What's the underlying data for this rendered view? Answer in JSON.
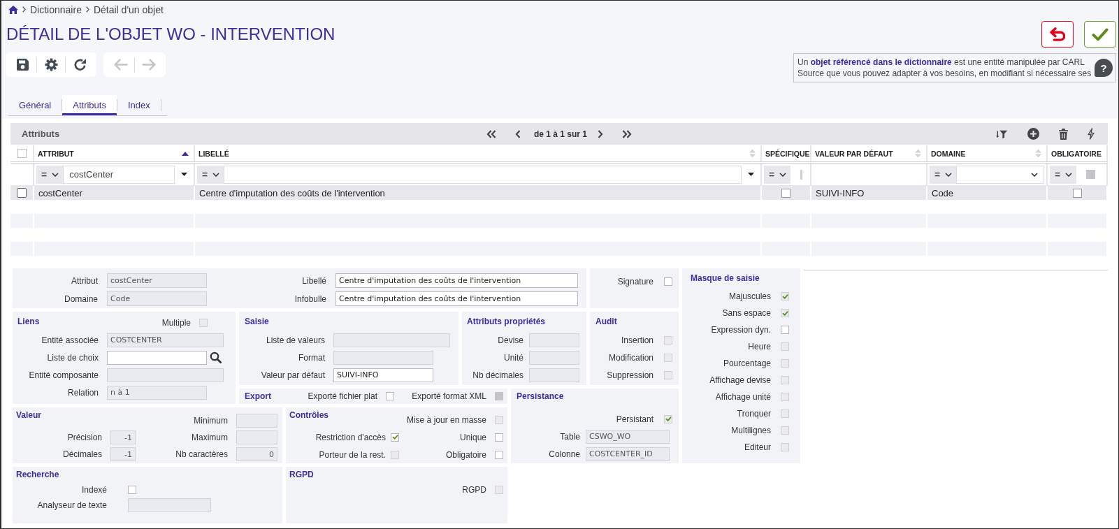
{
  "breadcrumb": [
    {
      "label": "Dictionnaire"
    },
    {
      "label": "Détail d'un objet"
    }
  ],
  "title": "DÉTAIL DE L'OBJET WO - INTERVENTION",
  "toolbar": [
    [
      {
        "kind": "save",
        "disabled": false
      },
      {
        "kind": "settings",
        "disabled": false
      },
      {
        "kind": "refresh",
        "disabled": false
      }
    ],
    [
      {
        "kind": "previous",
        "disabled": true
      },
      {
        "kind": "next",
        "disabled": true
      }
    ]
  ],
  "info": {
    "text": "Un **objet référencé dans le dictionnaire** est une entité manipulée par CARL\nSource que vous pouvez adapter à vos besoins, en modifiant si nécessaire ses",
    "help": "?"
  },
  "tabs": [
    {
      "label": "Général",
      "selected": false
    },
    {
      "label": "Attributs",
      "selected": true
    },
    {
      "label": "Index",
      "selected": false
    }
  ],
  "table": {
    "title": "Attributs",
    "pagination": "de 1 à 1 sur 1",
    "select_all": {
      "checked": false
    },
    "columns": [
      {
        "label": "ATTRIBUT",
        "sorted": true
      },
      {
        "label": "LIBELLÉ",
        "sorted": false
      },
      {
        "label": "SPÉCIFIQUE"
      },
      {
        "label": "VALEUR PAR DÉFAUT",
        "sorted": false
      },
      {
        "label": "DOMAINE",
        "sorted": false
      },
      {
        "label": "OBLIGATOIRE"
      }
    ],
    "filters": [
      {
        "kind": "text",
        "operator": "=",
        "value": "costCenter"
      },
      {
        "kind": "text",
        "operator": "="
      },
      {
        "kind": "clipped",
        "operator": "=",
        "checked": false,
        "indeterminate": true
      },
      {
        "kind": "none"
      },
      {
        "kind": "select",
        "operator": "="
      },
      {
        "kind": "checkbox",
        "operator": "=",
        "checked": false,
        "indeterminate": true
      }
    ],
    "rows": [
      {
        "selected": true,
        "checked": false,
        "cells": [
          {
            "kind": "text",
            "text": "costCenter"
          },
          {
            "kind": "text",
            "text": "Centre d'imputation des coûts de l'intervention"
          },
          {
            "kind": "checkbox",
            "checked": false
          },
          {
            "kind": "text",
            "text": "SUIVI-INFO"
          },
          {
            "kind": "text",
            "text": "Code"
          },
          {
            "kind": "checkbox",
            "checked": false
          }
        ]
      }
    ]
  },
  "detail": {
    "sections": [
      {
        "fields": [
          {
            "label": "Attribut",
            "kind": "text",
            "value": "costCenter",
            "readonly": true
          },
          {
            "label": "Libellé",
            "kind": "text",
            "value": "Centre d'imputation des coûts de l'intervention",
            "readonly": false
          },
          {
            "label": "Domaine",
            "kind": "text",
            "value": "Code",
            "readonly": true
          },
          {
            "label": "Infobulle",
            "kind": "text",
            "value": "Centre d'imputation des coûts de l'intervention",
            "readonly": false
          }
        ]
      },
      {
        "fields": [
          {
            "label": "Signature",
            "kind": "checkbox",
            "checked": false,
            "disabled": false
          }
        ]
      },
      {
        "title": "Liens",
        "fields": [
          {
            "label": "Multiple",
            "kind": "checkbox",
            "checked": false,
            "disabled": true
          },
          {
            "label": "Entité associée",
            "kind": "text",
            "value": "COSTCENTER",
            "readonly": true
          },
          {
            "label": "Liste de choix",
            "kind": "lookup",
            "readonly": false
          },
          {
            "label": "Entité composante",
            "kind": "text",
            "readonly": true
          },
          {
            "label": "Relation",
            "kind": "text",
            "value": "n à 1",
            "readonly": true
          }
        ]
      },
      {
        "title": "Saisie",
        "fields": [
          {
            "label": "Liste de valeurs",
            "kind": "text",
            "readonly": true
          },
          {
            "label": "Format",
            "kind": "text",
            "readonly": true
          },
          {
            "label": "Valeur par défaut",
            "kind": "text",
            "value": "SUIVI-INFO",
            "readonly": false
          }
        ]
      },
      {
        "title": "Attributs propriétés",
        "fields": [
          {
            "label": "Devise",
            "kind": "text",
            "readonly": true
          },
          {
            "label": "Unité",
            "kind": "text",
            "readonly": true
          },
          {
            "label": "Nb décimales",
            "kind": "text",
            "readonly": true
          }
        ]
      },
      {
        "title": "Audit",
        "fields": [
          {
            "label": "Insertion",
            "kind": "checkbox",
            "checked": false,
            "disabled": true
          },
          {
            "label": "Modification",
            "kind": "checkbox",
            "checked": false,
            "disabled": true
          },
          {
            "label": "Suppression",
            "kind": "checkbox",
            "checked": false,
            "disabled": true
          }
        ]
      },
      {
        "title": "Export",
        "fields": [
          {
            "label": "Exporté fichier plat",
            "kind": "checkbox",
            "checked": false,
            "disabled": false,
            "indeterminate": false
          },
          {
            "label": "Exporté format XML",
            "kind": "checkbox",
            "checked": false,
            "disabled": false,
            "indeterminate": true
          }
        ]
      },
      {
        "title": "Valeur",
        "fields": [
          {
            "label": "Minimum",
            "kind": "number",
            "readonly": true
          },
          {
            "label": "Précision",
            "kind": "number",
            "value": "-1",
            "readonly": true
          },
          {
            "label": "Maximum",
            "kind": "number",
            "readonly": true
          },
          {
            "label": "Décimales",
            "kind": "number",
            "value": "-1",
            "readonly": true
          },
          {
            "label": "Nb caractères",
            "kind": "number",
            "value": "0",
            "readonly": true
          }
        ]
      },
      {
        "title": "Contrôles",
        "fields": [
          {
            "label": "Mise à jour en masse",
            "kind": "checkbox",
            "checked": false,
            "disabled": true
          },
          {
            "label": "Restriction d'accès",
            "kind": "checkbox",
            "checked": true,
            "disabled": false
          },
          {
            "label": "Unique",
            "kind": "checkbox",
            "checked": false,
            "disabled": false
          },
          {
            "label": "Porteur de la rest.",
            "kind": "checkbox",
            "checked": false,
            "disabled": true
          },
          {
            "label": "Obligatoire",
            "kind": "checkbox",
            "checked": false,
            "disabled": false
          }
        ]
      },
      {
        "title": "Persistance",
        "fields": [
          {
            "label": "Persistant",
            "kind": "checkbox",
            "checked": true,
            "disabled": true
          },
          {
            "label": "Table",
            "kind": "text",
            "value": "CSWO_WO",
            "readonly": true
          },
          {
            "label": "Colonne",
            "kind": "text",
            "value": "COSTCENTER_ID",
            "readonly": true
          }
        ]
      },
      {
        "title": "Masque de saisie",
        "fields": [
          {
            "label": "Majuscules",
            "kind": "checkbox",
            "checked": true,
            "disabled": true
          },
          {
            "label": "Sans espace",
            "kind": "checkbox",
            "checked": true,
            "disabled": true
          },
          {
            "label": "Expression dyn.",
            "kind": "checkbox",
            "checked": false,
            "disabled": false
          },
          {
            "label": "Heure",
            "kind": "checkbox",
            "checked": false,
            "disabled": true
          },
          {
            "label": "Pourcentage",
            "kind": "checkbox",
            "checked": false,
            "disabled": true
          },
          {
            "label": "Affichage devise",
            "kind": "checkbox",
            "checked": false,
            "disabled": true
          },
          {
            "label": "Affichage unité",
            "kind": "checkbox",
            "checked": false,
            "disabled": true
          },
          {
            "label": "Tronquer",
            "kind": "checkbox",
            "checked": false,
            "disabled": true
          },
          {
            "label": "Multilignes",
            "kind": "checkbox",
            "checked": false,
            "disabled": true
          },
          {
            "label": "Editeur",
            "kind": "checkbox",
            "checked": false,
            "disabled": true
          }
        ]
      },
      {
        "title": "Recherche",
        "fields": [
          {
            "label": "Indexé",
            "kind": "checkbox",
            "checked": false,
            "disabled": false
          },
          {
            "label": "Analyseur de texte",
            "kind": "text",
            "readonly": true
          }
        ]
      },
      {
        "title": "RGPD",
        "fields": [
          {
            "label": "RGPD",
            "kind": "checkbox",
            "checked": false,
            "disabled": true
          }
        ]
      }
    ]
  }
}
